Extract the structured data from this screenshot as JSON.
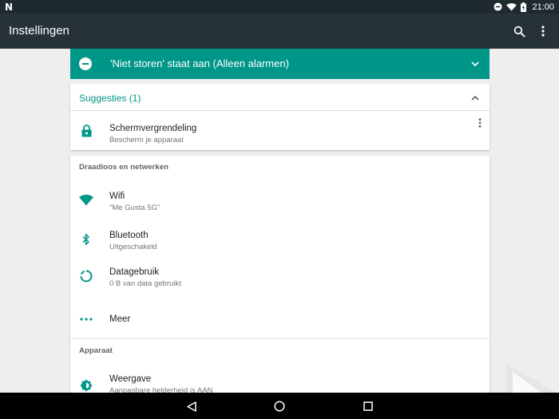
{
  "status_bar": {
    "time": "21:00",
    "left_icon": "N"
  },
  "toolbar": {
    "title": "Instellingen"
  },
  "dnd": {
    "text": "'Niet storen' staat aan (Alleen alarmen)"
  },
  "suggestions": {
    "header": "Suggesties (1)",
    "items": [
      {
        "title": "Schermvergrendeling",
        "subtitle": "Bescherm je apparaat",
        "icon": "lock-icon"
      }
    ]
  },
  "sections": [
    {
      "title": "Draadloos en netwerken",
      "items": [
        {
          "title": "Wifi",
          "subtitle": "\"Me Gusta 5G\"",
          "icon": "wifi-icon"
        },
        {
          "title": "Bluetooth",
          "subtitle": "Uitgeschakeld",
          "icon": "bluetooth-icon"
        },
        {
          "title": "Datagebruik",
          "subtitle": "0 B van data gebruikt",
          "icon": "data-usage-icon"
        },
        {
          "title": "Meer",
          "subtitle": "",
          "icon": "more-horiz-icon"
        }
      ]
    },
    {
      "title": "Apparaat",
      "items": [
        {
          "title": "Weergave",
          "subtitle": "Aanpasbare helderheid is AAN",
          "icon": "brightness-icon"
        }
      ]
    }
  ],
  "colors": {
    "accent": "#009688",
    "toolbar": "#263238",
    "status_bar": "#1f2a30"
  }
}
